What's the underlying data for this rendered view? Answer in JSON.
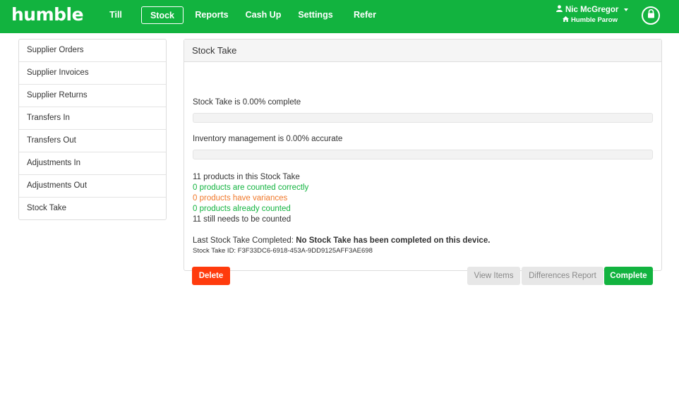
{
  "navbar": {
    "brand": "humble",
    "items": [
      {
        "label": "Till"
      },
      {
        "label": "Stock"
      },
      {
        "label": "Reports"
      },
      {
        "label": "Cash Up"
      },
      {
        "label": "Settings"
      },
      {
        "label": "Refer"
      }
    ],
    "active": "Stock",
    "user_name": "Nic McGregor",
    "store_name": "Humble Parow",
    "accent": "#12b33f"
  },
  "sidebar": {
    "items": [
      {
        "label": "Supplier Orders"
      },
      {
        "label": "Supplier Invoices"
      },
      {
        "label": "Supplier Returns"
      },
      {
        "label": "Transfers In"
      },
      {
        "label": "Transfers Out"
      },
      {
        "label": "Adjustments In"
      },
      {
        "label": "Adjustments Out"
      },
      {
        "label": "Stock Take"
      }
    ]
  },
  "panel": {
    "title": "Stock Take",
    "complete_text": "Stock Take is 0.00% complete",
    "complete_progress": 0,
    "accuracy_text": "Inventory management is 0.00% accurate",
    "accuracy_progress": 0,
    "stats": {
      "total": "11 products in this Stock Take",
      "correct": "0 products are counted correctly",
      "variances": "0 products have variances",
      "counted": "0 products already counted",
      "remaining": "11 still needs to be counted"
    },
    "last_completed_label": "Last Stock Take Completed:",
    "last_completed_value": "No Stock Take has been completed on this device.",
    "stock_take_id": "Stock Take ID: F3F33DC6-6918-453A-9DD9125AFF3AE698",
    "buttons": {
      "delete": "Delete",
      "view_items": "View Items",
      "differences": "Differences Report",
      "complete": "Complete"
    },
    "colors": {
      "danger": "#ff3b0d",
      "success": "#12b33f",
      "warning": "#f0782a"
    }
  }
}
